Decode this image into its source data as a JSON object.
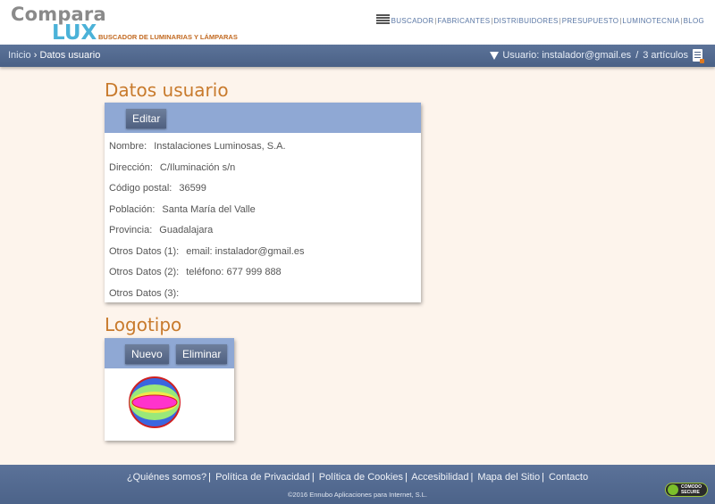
{
  "header": {
    "logo_top": "Compara",
    "logo_bottom": "LUX",
    "logo_tagline": "BUSCADOR DE LUMINARIAS Y LÁMPARAS",
    "nav": [
      "BUSCADOR",
      "FABRICANTES",
      "DISTRIBUIDORES",
      "PRESUPUESTO",
      "LUMINOTECNIA",
      "BLOG"
    ]
  },
  "breadcrumb": {
    "home": "Inicio",
    "separator": "›",
    "current": "Datos usuario"
  },
  "user": {
    "label": "Usuario: instalador@gmail.es",
    "divider": "/",
    "cart": "3 artículos"
  },
  "datos": {
    "title": "Datos usuario",
    "edit_label": "Editar",
    "rows": [
      {
        "label": "Nombre:",
        "value": "Instalaciones Luminosas, S.A."
      },
      {
        "label": "Dirección:",
        "value": "C/Iluminación s/n"
      },
      {
        "label": "Código postal:",
        "value": "36599"
      },
      {
        "label": "Población:",
        "value": "Santa María del Valle"
      },
      {
        "label": "Provincia:",
        "value": "Guadalajara"
      },
      {
        "label": "Otros Datos (1):",
        "value": "email: instalador@gmail.es"
      },
      {
        "label": "Otros Datos (2):",
        "value": "teléfono: 677 999 888"
      },
      {
        "label": "Otros Datos (3):",
        "value": ""
      }
    ]
  },
  "logotipo": {
    "title": "Logotipo",
    "new_label": "Nuevo",
    "delete_label": "Eliminar"
  },
  "footer": {
    "links": [
      "¿Quiénes somos?",
      "Política de Privacidad",
      "Política de Cookies",
      "Accesibilidad",
      "Mapa del Sitio",
      "Contacto"
    ],
    "copyright": "©2016 Ennubo Aplicaciones para Internet, S.L.",
    "badge_line1": "COMODO",
    "badge_line2": "SECURE"
  },
  "colors": {
    "accent_orange": "#c87a2c",
    "bar_blue": "#4a6186",
    "card_head_blue": "#8fa8d4",
    "logo_blue": "#4bb2d8",
    "background": "#fdf4ec"
  }
}
